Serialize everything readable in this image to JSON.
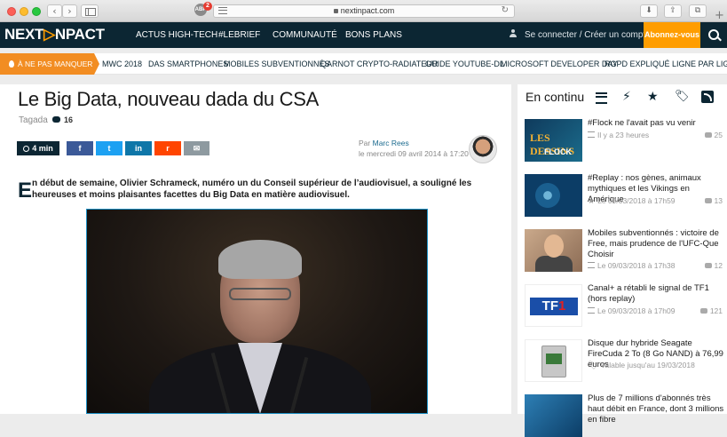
{
  "browser": {
    "url": "nextinpact.com",
    "back_label": "‹",
    "forward_label": "›",
    "extension_label": "ABP",
    "extension_badge": "2",
    "reload_label": "↻",
    "download_label": "⬇",
    "share_label": "⇪",
    "tabs_label": "⧉",
    "newtab_label": "+"
  },
  "site": {
    "logo_left": "NEXT",
    "logo_accent": "▷",
    "logo_right": "NPACT",
    "nav": [
      "ACTUS HIGH-TECH",
      "#LEBRIEF",
      "COMMUNAUTÉ",
      "BONS PLANS"
    ],
    "connect_label": "Se connecter / Créer un compte",
    "subscribe_label": "Abonnez-vous"
  },
  "trending": {
    "tag": "À NE PAS MANQUER",
    "items": [
      "MWC 2018",
      "DAS SMARTPHONES",
      "MOBILES SUBVENTIONNÉS",
      "QARNOT CRYPTO-RADIATEUR",
      "GUIDE YOUTUBE-DL",
      "MICROSOFT DEVELOPER DAY",
      "RGPD EXPLIQUÉ LIGNE PAR LIGNE"
    ]
  },
  "article": {
    "title": "Le Big Data, nouveau dada du CSA",
    "category": "Tagada",
    "comment_count": "16",
    "read_time": "4 min",
    "share": {
      "facebook": "f",
      "twitter": "t",
      "linkedin": "in",
      "reddit": "r",
      "email": "✉"
    },
    "author_prefix": "Par",
    "author": "Marc Rees",
    "date": "le mercredi 09 avril 2014 à 17:20",
    "lead_initial": "E",
    "lead_text": "n début de semaine, Olivier Schrameck, numéro un du Conseil supérieur de l’audiovisuel, a souligné les heureuses et moins plaisantes facettes du Big Data en matière audiovisuel."
  },
  "feed": {
    "title": "En continu",
    "filter_icons": [
      "list-icon",
      "bolt-icon",
      "star-icon",
      "tag-icon",
      "rss-icon"
    ],
    "items": [
      {
        "headline": "#Flock ne l'avait pas vu venir",
        "meta": "Il y a 23 heures",
        "count": "25",
        "thumb_top": "LES DESSINS",
        "thumb_bottom": "FLOCK"
      },
      {
        "headline": "#Replay : nos gènes, animaux mythiques et les Vikings en Amérique",
        "meta": "Le 09/03/2018 à 17h59",
        "count": "13"
      },
      {
        "headline": "Mobiles subventionnés : victoire de Free, mais prudence de l'UFC-Que Choisir",
        "meta": "Le 09/03/2018 à 17h38",
        "count": "12"
      },
      {
        "headline": "Canal+ a rétabli le signal de TF1 (hors replay)",
        "meta": "Le 09/03/2018 à 17h09",
        "count": "121",
        "thumb_text": "TF",
        "thumb_accent": "1"
      },
      {
        "headline": "Disque dur hybride Seagate FireCuda 2 To (8 Go NAND) à 76,99 euros",
        "meta": "Valable jusqu'au 19/03/2018",
        "count": ""
      },
      {
        "headline": "Plus de 7 millions d'abonnés très haut débit en France, dont 3 millions en fibre",
        "meta": "",
        "count": ""
      }
    ]
  }
}
